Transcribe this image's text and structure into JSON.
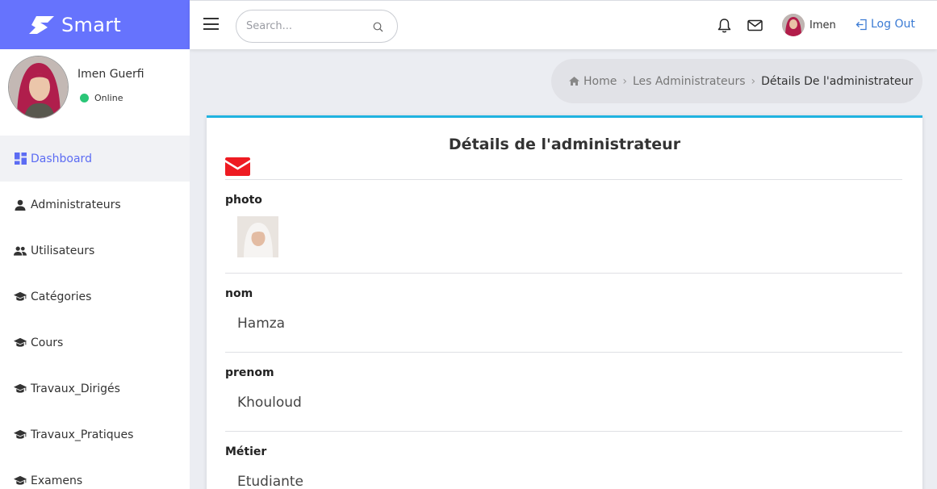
{
  "brand": {
    "name": "Smart",
    "color": "#6673fd"
  },
  "topbar": {
    "search_placeholder": "Search...",
    "user_name": "Imen",
    "logout_label": "Log Out",
    "icons": [
      "menu-icon",
      "search-icon",
      "bell-icon",
      "mail-icon",
      "logout-icon"
    ]
  },
  "sidebar": {
    "profile_name": "Imen Guerfi",
    "status": "Online",
    "status_color": "#2ac677",
    "items": [
      {
        "label": "Dashboard",
        "icon": "dashboard-icon",
        "active": true
      },
      {
        "label": "Administrateurs",
        "icon": "person-icon"
      },
      {
        "label": "Utilisateurs",
        "icon": "people-icon"
      },
      {
        "label": "Catégories",
        "icon": "graduation-cap-icon"
      },
      {
        "label": "Cours",
        "icon": "graduation-cap-icon"
      },
      {
        "label": "Travaux_Dirigés",
        "icon": "graduation-cap-icon"
      },
      {
        "label": "Travaux_Pratiques",
        "icon": "graduation-cap-icon"
      },
      {
        "label": "Examens",
        "icon": "graduation-cap-icon"
      }
    ]
  },
  "breadcrumb": {
    "home": "Home",
    "section": "Les Administrateurs",
    "current": "Détails De l'administrateur"
  },
  "card": {
    "title": "Détails de l'administrateur",
    "accent_color": "#20b3e0",
    "mail_icon_color": "#ee1b22",
    "fields": [
      {
        "label": "photo"
      },
      {
        "label": "nom",
        "value": "Hamza"
      },
      {
        "label": "prenom",
        "value": "Khouloud"
      },
      {
        "label": "Métier",
        "value": "Etudiante"
      }
    ]
  }
}
